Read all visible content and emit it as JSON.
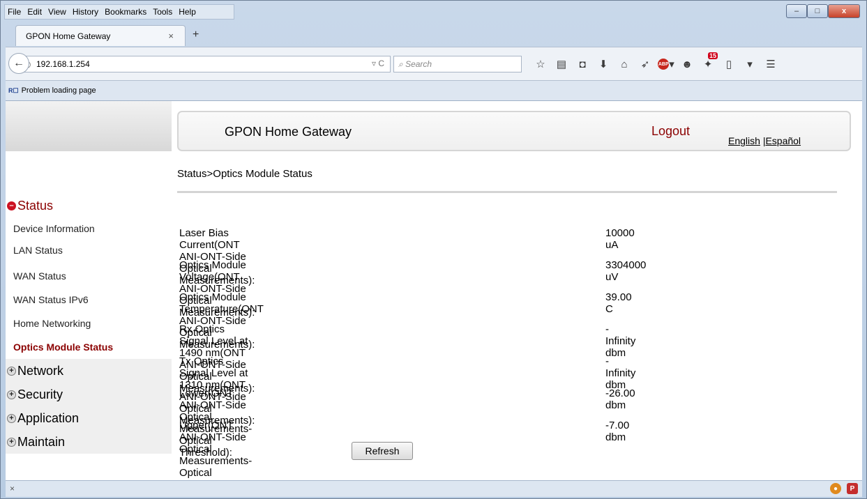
{
  "menubar": {
    "items": [
      "File",
      "Edit",
      "View",
      "History",
      "Bookmarks",
      "Tools",
      "Help"
    ]
  },
  "window_controls": {
    "minimize": "–",
    "maximize": "□",
    "close": "x"
  },
  "tab": {
    "title": "GPON Home Gateway",
    "close": "×",
    "new_tab": "+"
  },
  "navbar": {
    "url": "192.168.1.254",
    "search_placeholder": "Search",
    "toolbar_icons": [
      "bookmark-star-icon",
      "reading-list-icon",
      "pocket-icon",
      "download-icon",
      "home-icon",
      "send-icon",
      "adblock-icon",
      "chat-icon",
      "notifications-icon",
      "clipboard-icon",
      "dropdown-icon",
      "menu-icon"
    ],
    "notification_count": "15",
    "abp_label": "ABP"
  },
  "bookmarks_bar": {
    "item": "Problem loading page"
  },
  "header": {
    "title": "GPON Home Gateway",
    "logout": "Logout",
    "lang_english": "English",
    "lang_sep": "|",
    "lang_spanish": "Español"
  },
  "breadcrumb": "Status>Optics Module Status",
  "sidebar": {
    "status": {
      "label": "Status",
      "items": [
        "Device Information",
        "LAN Status",
        "WAN Status",
        "WAN Status IPv6",
        "Home Networking",
        "Optics Module Status"
      ]
    },
    "network": "Network",
    "security": "Security",
    "application": "Application",
    "maintain": "Maintain"
  },
  "rows": [
    {
      "label": "Laser Bias Current(ONT ANI-ONT-Side Optical Measurements):",
      "value": "10000 uA"
    },
    {
      "label": "Optics Module Voltage(ONT ANI-ONT-Side Optical Measurements):",
      "value": "3304000 uV"
    },
    {
      "label": "Optics Module Temperature(ONT ANI-ONT-Side Optical Measurements):",
      "value": "39.00 C"
    },
    {
      "label": "Rx Optics Signal Level at 1490 nm(ONT ANI-ONT-Side Optical Measurements):",
      "value": "-Infinity dbm"
    },
    {
      "label": "Tx Optics Signal Level at 1310 nm(ONT ANI-ONT-Side Optical Measurements):",
      "value": "-Infinity dbm"
    },
    {
      "label": "Lower(ONT ANI-ONT-Side Optical Measurements-Optical Threshold):",
      "value": "-26.00 dbm"
    },
    {
      "label": "Upper(ONT ANI-ONT-Side Optical Measurements-Optical Threshold):",
      "value": "-7.00 dbm"
    }
  ],
  "refresh_button": "Refresh",
  "statusbar": {
    "close": "×"
  },
  "colors": {
    "accent": "#8b0000",
    "chrome": "#c9d8ea"
  }
}
